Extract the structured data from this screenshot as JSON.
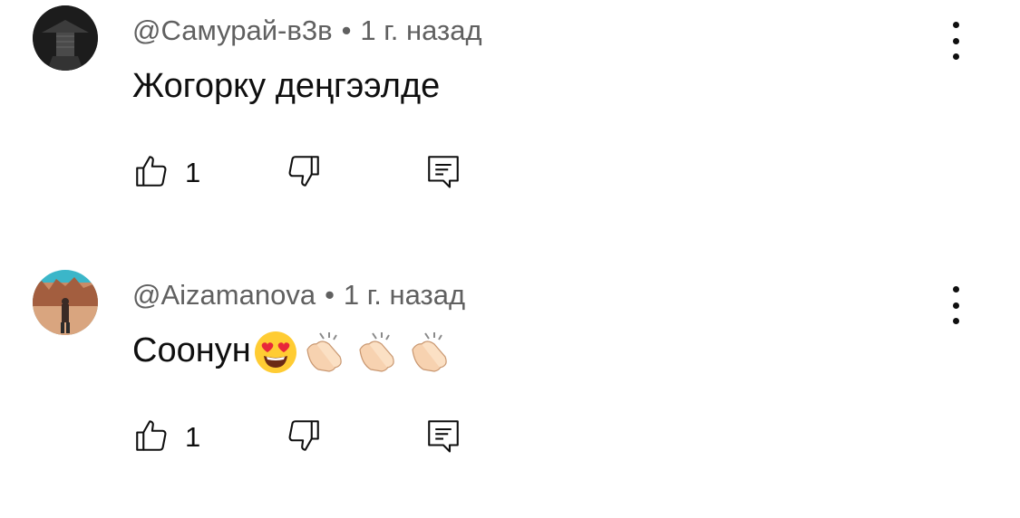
{
  "comments": [
    {
      "author": "@Самурай-в3в",
      "separator": "•",
      "time": "1 г. назад",
      "text": "Жогорку деңгээлде",
      "emojis": [],
      "likes": "1",
      "avatar": "samurai-avatar"
    },
    {
      "author": "@Aizamanova",
      "separator": "•",
      "time": "1 г. назад",
      "text": "Соонун",
      "emojis": [
        "heart-eyes-emoji",
        "clapping-hands-emoji",
        "clapping-hands-emoji",
        "clapping-hands-emoji"
      ],
      "likes": "1",
      "avatar": "canyon-photo-avatar"
    }
  ],
  "icons": {
    "like": "thumbs-up-icon",
    "dislike": "thumbs-down-icon",
    "reply": "reply-comment-icon",
    "more": "more-vertical-icon"
  },
  "colors": {
    "text": "#0f0f0f",
    "meta": "#606060",
    "background": "#ffffff"
  }
}
